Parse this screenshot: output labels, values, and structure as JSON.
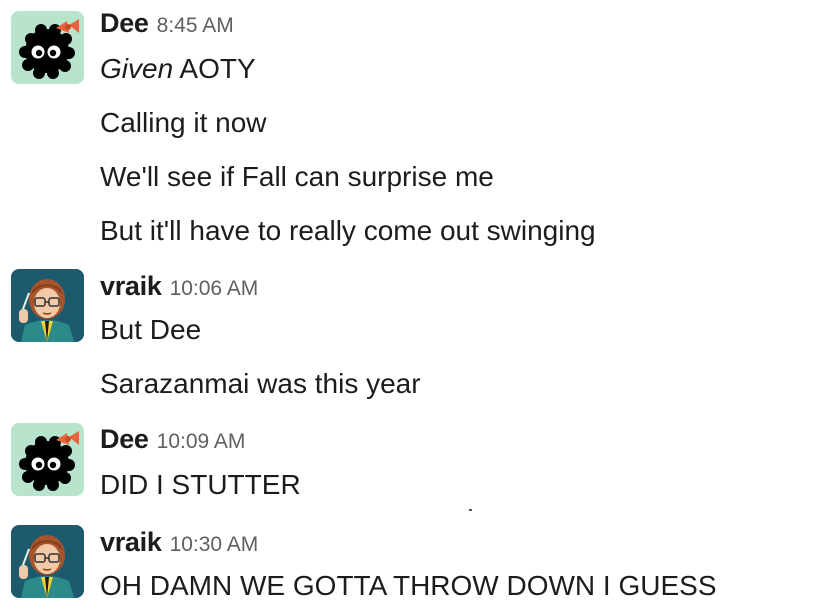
{
  "messages": [
    {
      "author": "Dee",
      "time": "8:45 AM",
      "avatar_icon": "soot-sprite-avatar-icon",
      "lines": [
        "AOTY",
        "Calling it now",
        "We'll see if Fall can surprise me",
        "But it'll have to really come out swinging"
      ],
      "first_line_italic_prefix": "Given"
    },
    {
      "author": "vraik",
      "time": "10:06 AM",
      "avatar_icon": "cartoon-woman-avatar-icon",
      "lines": [
        "But Dee",
        "Sarazanmai was this year"
      ]
    },
    {
      "author": "Dee",
      "time": "10:09 AM",
      "avatar_icon": "soot-sprite-avatar-icon",
      "lines": [
        "DID I STUTTER"
      ]
    },
    {
      "author": "vraik",
      "time": "10:30 AM",
      "avatar_icon": "cartoon-woman-avatar-icon",
      "lines": [
        "OH DAMN WE GOTTA THROW DOWN I GUESS"
      ]
    }
  ],
  "colors": {
    "name": "#1d1c1d",
    "timestamp": "#616061",
    "message_text": "#1d1c1d",
    "soot_avatar_bg": "#b8e3cc",
    "soot_bow": "#e8643c",
    "vraik_avatar_bg": "#1e5a6e"
  }
}
